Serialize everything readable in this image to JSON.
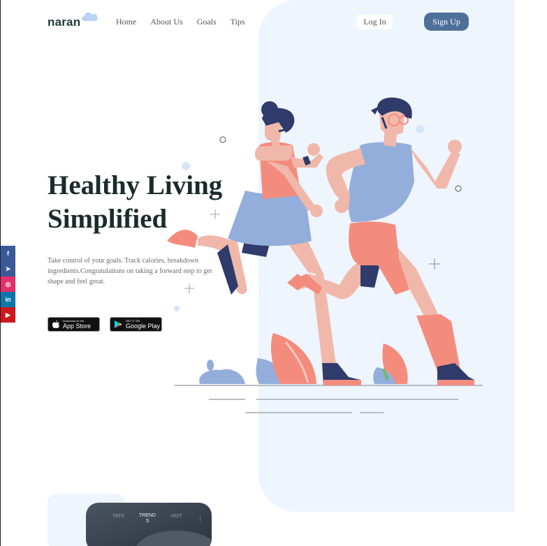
{
  "brand": {
    "name": "naran"
  },
  "nav": {
    "items": [
      "Home",
      "About Us",
      "Goals",
      "Tips"
    ]
  },
  "auth": {
    "login_label": "Log In",
    "signup_label": "Sign Up"
  },
  "hero": {
    "headline_line1": "Healthy Living",
    "headline_line2": "Simplified",
    "description": "Take control of your goals. Track calories, breakdown ingredients.Congratulations on taking a forward step to get shape and feel great."
  },
  "stores": {
    "app_store": {
      "small": "Download on the",
      "big": "App Store"
    },
    "google_play": {
      "small": "GET IT ON",
      "big": "Google Play"
    }
  },
  "social": {
    "items": [
      {
        "name": "facebook",
        "color": "#3b5998",
        "glyph": "f"
      },
      {
        "name": "telegram",
        "color": "#3b5998",
        "glyph": "➤"
      },
      {
        "name": "instagram",
        "color": "#e1306c",
        "glyph": "◎"
      },
      {
        "name": "linkedin",
        "color": "#0e76a8",
        "glyph": "in"
      },
      {
        "name": "youtube",
        "color": "#cc181e",
        "glyph": "▶"
      }
    ]
  },
  "app_preview": {
    "tab_left": "TATS",
    "tab_active_line1": "TREND",
    "tab_active_line2": "S",
    "tab_right": "HIST",
    "menu_glyph": "⋮"
  },
  "colors": {
    "accent": "#4f6f9b",
    "hero_bg": "#eef5fd",
    "coral": "#f48c7e",
    "blue": "#94aedb",
    "navy": "#2f3b6b"
  }
}
